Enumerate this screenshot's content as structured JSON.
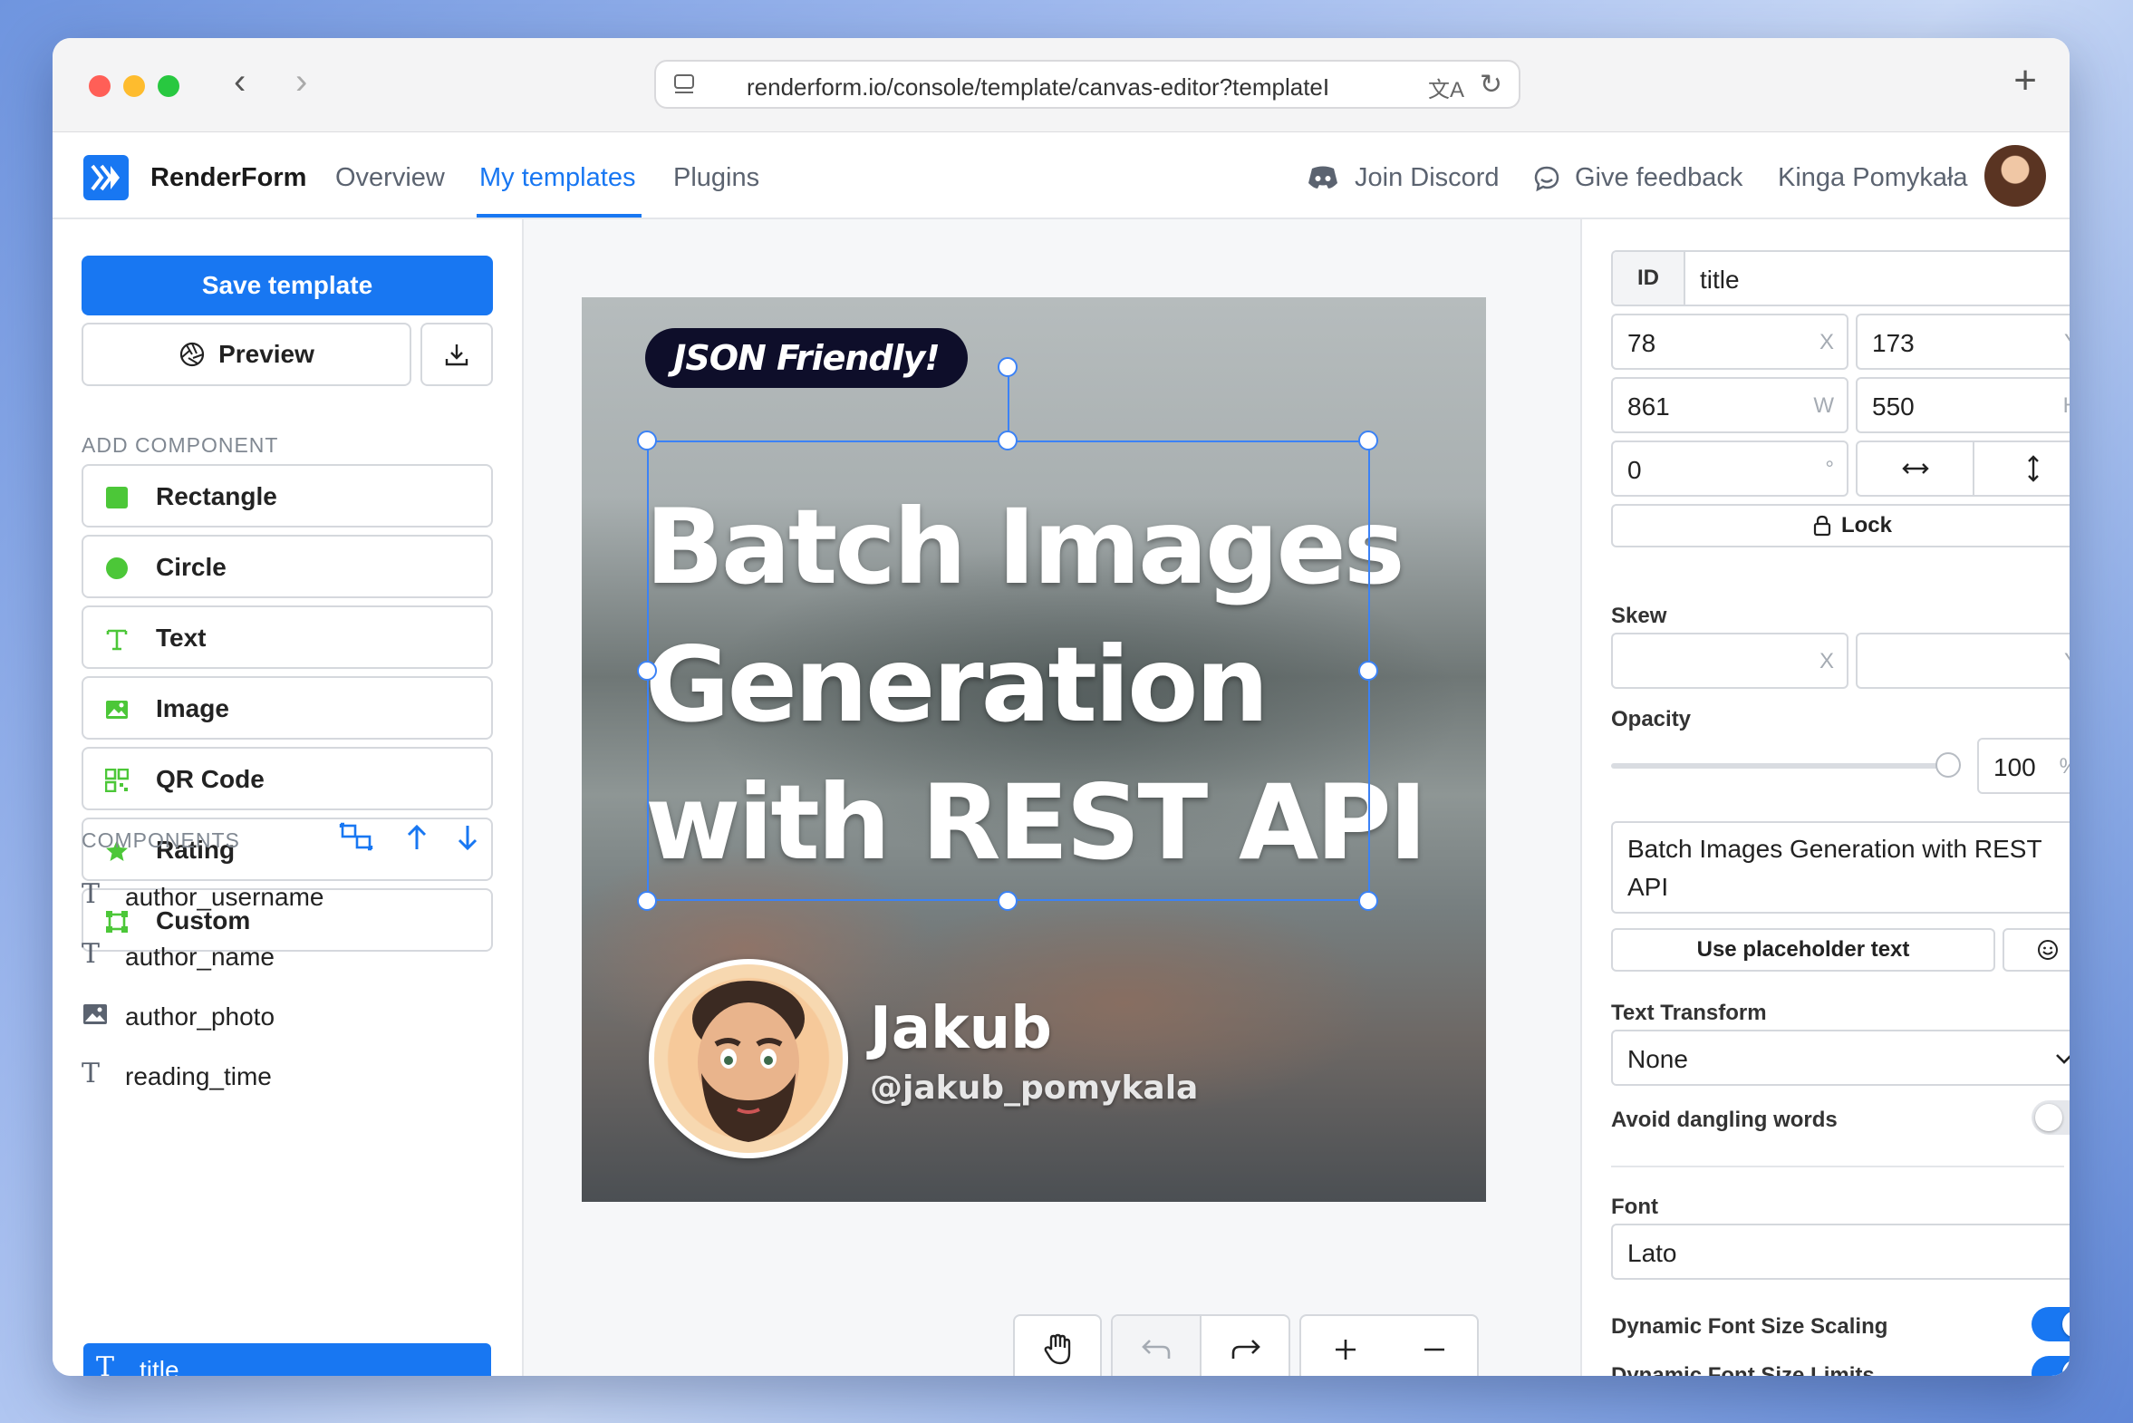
{
  "browser": {
    "url": "renderform.io/console/template/canvas-editor?templateI",
    "nav_back": "‹",
    "nav_forward": "›",
    "new_tab": "+"
  },
  "header": {
    "brand": "RenderForm",
    "nav": [
      "Overview",
      "My templates",
      "Plugins"
    ],
    "join_discord": "Join Discord",
    "give_feedback": "Give feedback",
    "user_name": "Kinga Pomykała",
    "accent_color": "#1877f2"
  },
  "sidebar": {
    "save_label": "Save template",
    "preview_label": "Preview",
    "add_component_label": "ADD COMPONENT",
    "add_components": [
      {
        "label": "Rectangle",
        "icon": "square-icon"
      },
      {
        "label": "Circle",
        "icon": "circle-icon"
      },
      {
        "label": "Text",
        "icon": "text-icon"
      },
      {
        "label": "Image",
        "icon": "image-icon"
      },
      {
        "label": "QR Code",
        "icon": "qr-code-icon"
      },
      {
        "label": "Rating",
        "icon": "star-icon"
      },
      {
        "label": "Custom",
        "icon": "custom-shape-icon"
      }
    ],
    "components_label": "COMPONENTS",
    "layers": [
      {
        "label": "author_username",
        "icon": "text-icon"
      },
      {
        "label": "author_name",
        "icon": "text-icon"
      },
      {
        "label": "author_photo",
        "icon": "image-icon"
      },
      {
        "label": "reading_time",
        "icon": "text-icon"
      },
      {
        "label": "title",
        "icon": "text-icon",
        "selected": true
      }
    ]
  },
  "canvas": {
    "badge": "JSON Friendly!",
    "title_lines": [
      "Batch Images",
      "Generation",
      "with REST API"
    ],
    "author_name": "Jakub",
    "author_username": "@jakub_pomykala"
  },
  "properties": {
    "id_label": "ID",
    "id_value": "title",
    "x": "78",
    "x_suffix": "X",
    "y": "173",
    "y_suffix": "Y",
    "w": "861",
    "w_suffix": "W",
    "h": "550",
    "h_suffix": "H",
    "rotation": "0",
    "rotation_suffix": "°",
    "lock_label": "Lock",
    "skew_label": "Skew",
    "skew_x_suffix": "X",
    "skew_y_suffix": "Y",
    "opacity_label": "Opacity",
    "opacity_value": "100",
    "opacity_suffix": "%",
    "opacity_fraction": 1.0,
    "text_value": "Batch Images Generation with REST API",
    "placeholder_button": "Use placeholder text",
    "text_transform_label": "Text Transform",
    "text_transform_value": "None",
    "avoid_dangling_label": "Avoid dangling words",
    "avoid_dangling_on": false,
    "font_label": "Font",
    "font_value": "Lato",
    "dyn_scaling_label": "Dynamic Font Size Scaling",
    "dyn_scaling_on": true,
    "dyn_limits_label": "Dynamic Font Size Limits",
    "dyn_limits_on": true
  }
}
